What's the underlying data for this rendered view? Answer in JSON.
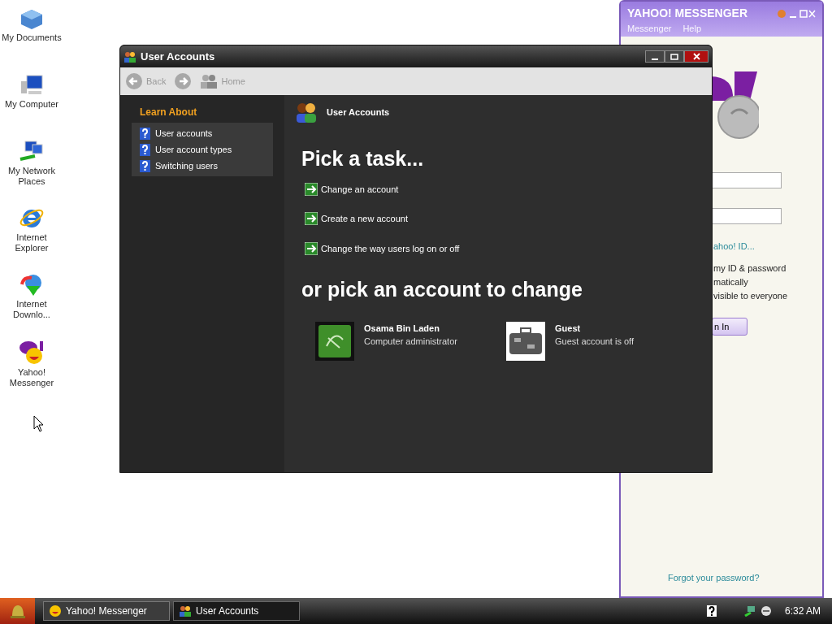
{
  "desktop_icons": [
    {
      "label": "My Documents"
    },
    {
      "label": "My Computer"
    },
    {
      "label": "My Network Places"
    },
    {
      "label": "Internet Explorer"
    },
    {
      "label": "Internet Downlo..."
    },
    {
      "label": "Yahoo! Messenger"
    }
  ],
  "messenger": {
    "title": "YAHOO! MESSENGER",
    "menu": [
      "Messenger",
      "Help"
    ],
    "id_link": "ahoo! ID...",
    "options": [
      "my ID & password",
      "matically",
      "visible to everyone"
    ],
    "sign_in": "n In",
    "forgot": "Forgot your password?"
  },
  "window": {
    "title": "User Accounts",
    "toolbar": [
      {
        "label": "Back",
        "kind": "back",
        "disabled": true
      },
      {
        "kind": "forward",
        "disabled": true
      },
      {
        "label": "Home",
        "kind": "home",
        "disabled": true
      }
    ],
    "learn_about": {
      "heading": "Learn About",
      "items": [
        "User accounts",
        "User account types",
        "Switching users"
      ]
    },
    "header": "User Accounts",
    "task_heading": "Pick a task...",
    "tasks": [
      "Change an account",
      "Create a new account",
      "Change the way users log on or off"
    ],
    "accounts_heading": "or pick an account to change",
    "accounts": [
      {
        "name": "Osama Bin Laden",
        "description": "Computer administrator",
        "kind": "admin"
      },
      {
        "name": "Guest",
        "description": "Guest account is off",
        "kind": "guest"
      }
    ]
  },
  "taskbar": {
    "tasks": [
      {
        "label": "Yahoo! Messenger",
        "kind": "messenger",
        "selected": false
      },
      {
        "label": "User Accounts",
        "kind": "accounts",
        "selected": true
      }
    ],
    "clock": "6:32 AM"
  }
}
